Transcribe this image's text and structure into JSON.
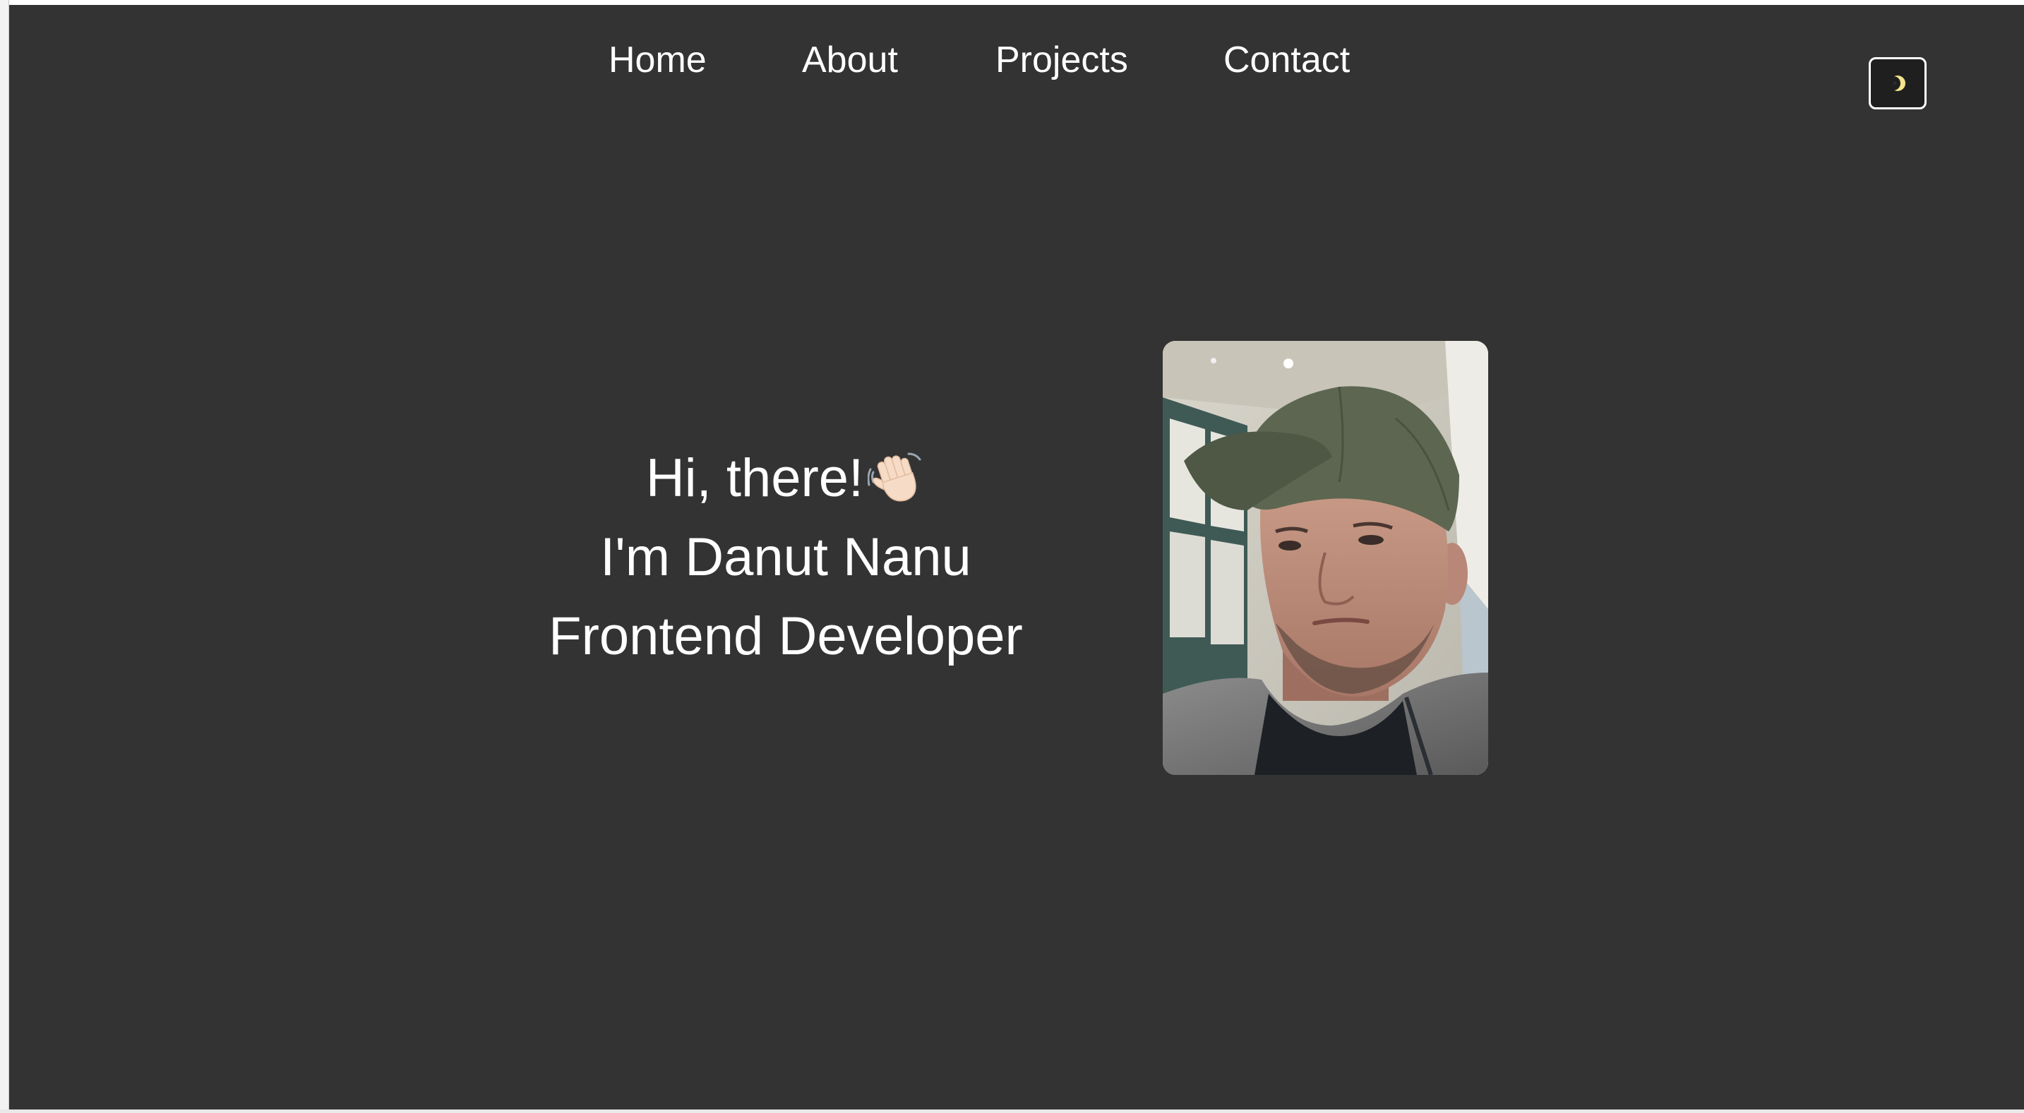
{
  "nav": {
    "items": [
      {
        "label": "Home"
      },
      {
        "label": "About"
      },
      {
        "label": "Projects"
      },
      {
        "label": "Contact"
      }
    ],
    "theme_toggle_icon": "moon-icon"
  },
  "hero": {
    "greeting": "Hi, there!",
    "greeting_icon": "waving-hand-icon",
    "name_line": "I'm Danut Nanu",
    "role_line": "Frontend Developer",
    "photo_icon": "profile-photo"
  },
  "colors": {
    "background": "#333333",
    "text": "#ffffff",
    "toggle_border": "#ffffff",
    "moon": "#f4e48a"
  }
}
